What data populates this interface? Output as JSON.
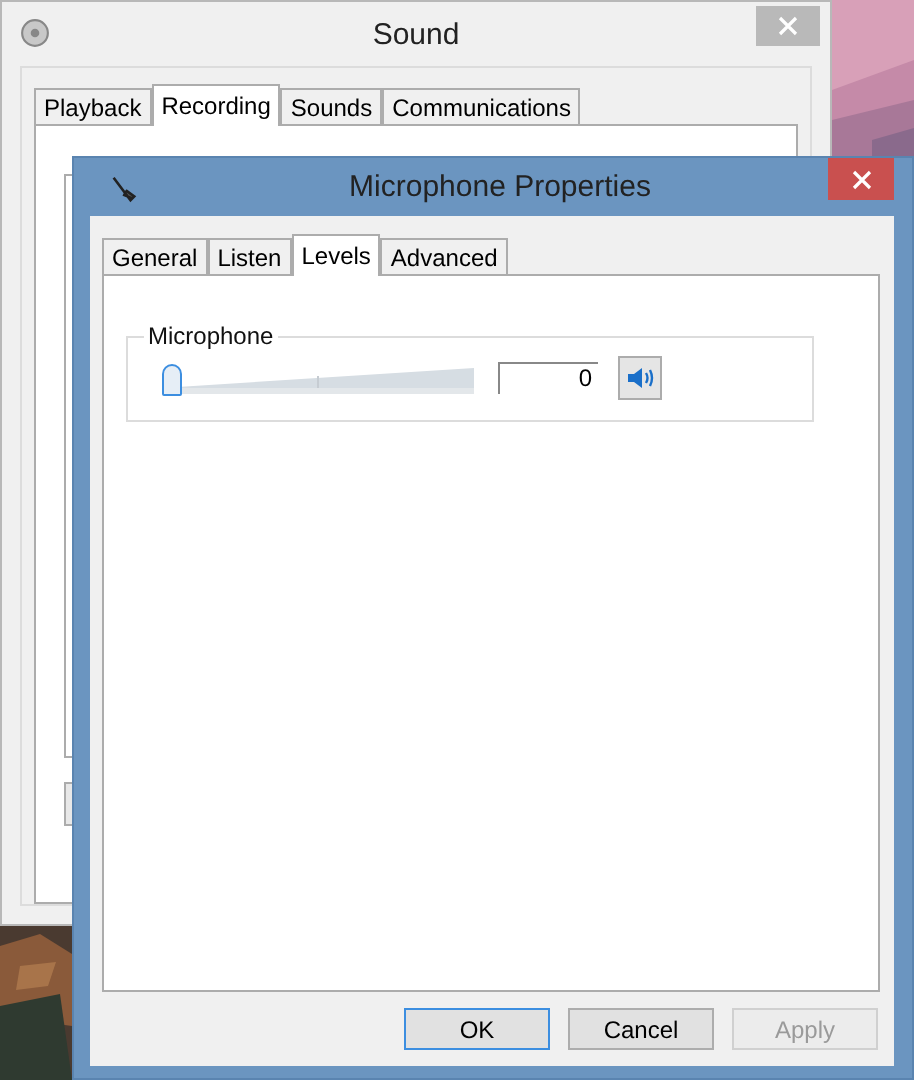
{
  "sound_window": {
    "title": "Sound",
    "tabs": [
      {
        "label": "Playback",
        "selected": false
      },
      {
        "label": "Recording",
        "selected": true
      },
      {
        "label": "Sounds",
        "selected": false
      },
      {
        "label": "Communications",
        "selected": false
      }
    ]
  },
  "properties_window": {
    "title": "Microphone Properties",
    "tabs": [
      {
        "label": "General",
        "selected": false
      },
      {
        "label": "Listen",
        "selected": false
      },
      {
        "label": "Levels",
        "selected": true
      },
      {
        "label": "Advanced",
        "selected": false
      }
    ],
    "levels": [
      {
        "label": "Microphone",
        "level": 0,
        "value": "0",
        "muted": false
      }
    ],
    "buttons": [
      {
        "label": "OK",
        "kind": "default"
      },
      {
        "label": "Cancel",
        "kind": "normal"
      },
      {
        "label": "Apply",
        "kind": "disabled"
      }
    ]
  }
}
